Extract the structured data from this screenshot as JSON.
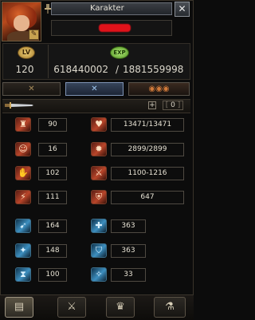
{
  "window": {
    "title": "Karakter",
    "close_glyph": "✕"
  },
  "character": {
    "name": "",
    "level": "120"
  },
  "badges": {
    "lv": "LV",
    "exp": "EXP"
  },
  "exp": {
    "current": "618440002",
    "separator": "/",
    "max": "1881559998"
  },
  "modes": [
    {
      "icon": "crossed-swords-icon",
      "glyph": "✕"
    },
    {
      "icon": "crossed-blades-icon",
      "glyph": "✕"
    },
    {
      "icon": "orb-icon",
      "glyph": "◉◉◉"
    }
  ],
  "weapon_bar": {
    "plus": "+",
    "points": "0",
    "open": "[",
    "close": "]"
  },
  "stats_left": [
    {
      "icon": "strength-icon",
      "glyph": "♜",
      "value": "90"
    },
    {
      "icon": "intelligence-icon",
      "glyph": "☺",
      "value": "16"
    },
    {
      "icon": "dexterity-icon",
      "glyph": "✋",
      "value": "102"
    },
    {
      "icon": "vitality-icon",
      "glyph": "⚡",
      "value": "111"
    }
  ],
  "stats_right": [
    {
      "icon": "health-icon",
      "glyph": "♥",
      "value": "13471/13471"
    },
    {
      "icon": "mana-icon",
      "glyph": "✹",
      "value": "2899/2899"
    },
    {
      "icon": "attack-icon",
      "glyph": "⚔",
      "value": "1100-1216"
    },
    {
      "icon": "defense-icon",
      "glyph": "⛨",
      "value": "647"
    }
  ],
  "resist_left": [
    {
      "icon": "attack-speed-icon",
      "glyph": "➹",
      "value": "164"
    },
    {
      "icon": "cast-speed-icon",
      "glyph": "✦",
      "value": "148"
    },
    {
      "icon": "hourglass-icon",
      "glyph": "⧗",
      "value": "100"
    }
  ],
  "resist_right": [
    {
      "icon": "magic-attack-icon",
      "glyph": "✚",
      "value": "363"
    },
    {
      "icon": "magic-defense-icon",
      "glyph": "⛉",
      "value": "363"
    },
    {
      "icon": "crit-icon",
      "glyph": "✧",
      "value": "33"
    }
  ],
  "tabs": [
    {
      "icon": "character-card-icon",
      "glyph": "▤"
    },
    {
      "icon": "weapon-tab-icon",
      "glyph": "⚔"
    },
    {
      "icon": "armor-tab-icon",
      "glyph": "♛"
    },
    {
      "icon": "potion-tab-icon",
      "glyph": "⚗"
    }
  ]
}
